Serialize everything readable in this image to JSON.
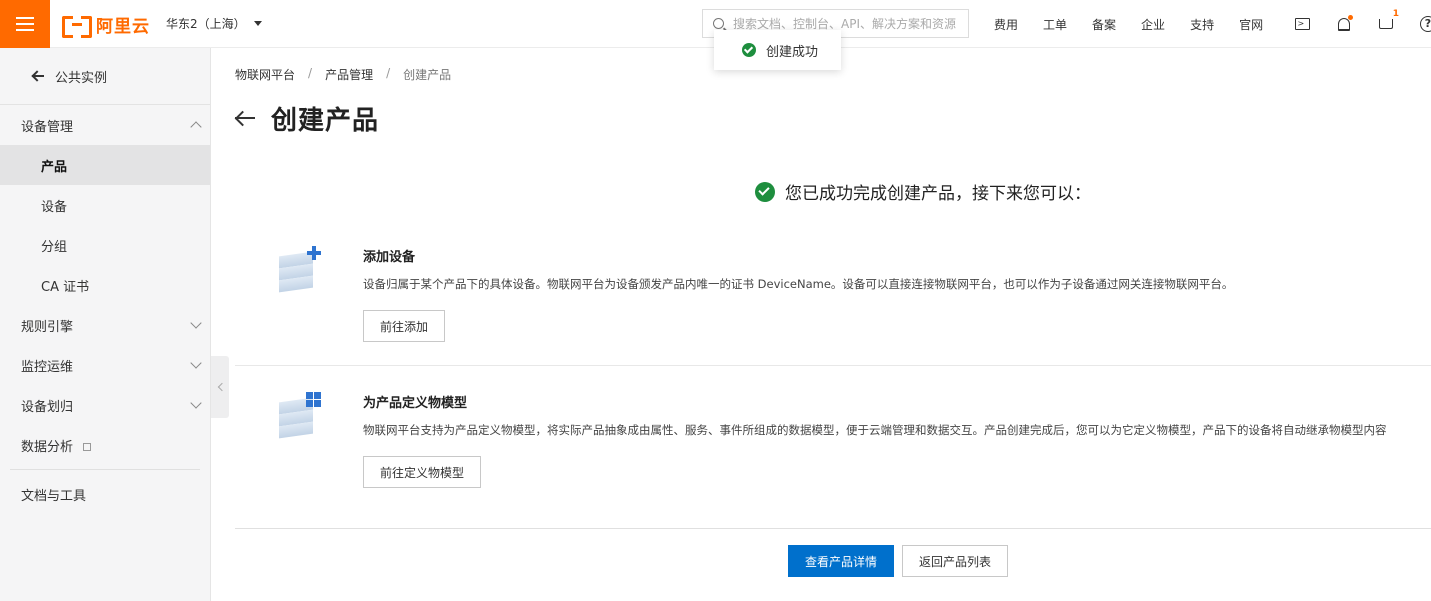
{
  "header": {
    "logo_text": "阿里云",
    "region": "华东2（上海）",
    "search_placeholder": "搜索文档、控制台、API、解决方案和资源",
    "nav": [
      "费用",
      "工单",
      "备案",
      "企业",
      "支持",
      "官网"
    ],
    "cart_badge": "1"
  },
  "toast": {
    "text": "创建成功"
  },
  "sidebar": {
    "back_label": "公共实例",
    "groups": [
      {
        "label": "设备管理",
        "expanded": true,
        "items": [
          "产品",
          "设备",
          "分组",
          "CA 证书"
        ],
        "active": "产品"
      },
      {
        "label": "规则引擎",
        "expanded": false
      },
      {
        "label": "监控运维",
        "expanded": false
      },
      {
        "label": "设备划归",
        "expanded": false
      }
    ],
    "data_analysis": "数据分析",
    "docs_tools": "文档与工具"
  },
  "main": {
    "breadcrumb": [
      "物联网平台",
      "产品管理",
      "创建产品"
    ],
    "title": "创建产品",
    "success_message": "您已成功完成创建产品，接下来您可以：",
    "steps": [
      {
        "title": "添加设备",
        "description": "设备归属于某个产品下的具体设备。物联网平台为设备颁发产品内唯一的证书 DeviceName。设备可以直接连接物联网平台，也可以作为子设备通过网关连接物联网平台。",
        "button": "前往添加"
      },
      {
        "title": "为产品定义物模型",
        "description": "物联网平台支持为产品定义物模型，将实际产品抽象成由属性、服务、事件所组成的数据模型，便于云端管理和数据交互。产品创建完成后，您可以为它定义物模型，产品下的设备将自动继承物模型内容",
        "button": "前往定义物模型"
      }
    ],
    "primary_button": "查看产品详情",
    "secondary_button": "返回产品列表"
  },
  "colors": {
    "brand": "#ff6a00",
    "primary": "#0070cc",
    "success": "#1e8e3e"
  }
}
